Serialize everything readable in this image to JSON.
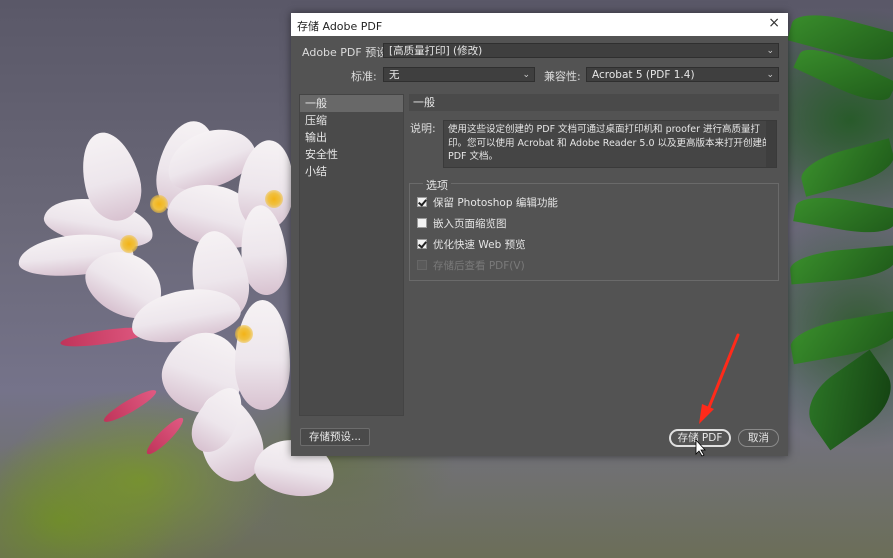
{
  "dialog": {
    "title": "存储 Adobe PDF",
    "close_label": "×"
  },
  "preset": {
    "label": "Adobe PDF 预设:",
    "value": "[高质量打印] (修改)"
  },
  "standard": {
    "label": "标准:",
    "value": "无"
  },
  "compat": {
    "label": "兼容性:",
    "value": "Acrobat 5 (PDF 1.4)"
  },
  "sidebar": {
    "items": [
      {
        "label": "一般",
        "active": true
      },
      {
        "label": "压缩",
        "active": false
      },
      {
        "label": "输出",
        "active": false
      },
      {
        "label": "安全性",
        "active": false
      },
      {
        "label": "小结",
        "active": false
      }
    ]
  },
  "panel": {
    "title": "一般",
    "desc_label": "说明:",
    "desc_text": "使用这些设定创建的 PDF 文档可通过桌面打印机和 proofer 进行高质量打印。您可以使用 Acrobat 和 Adobe Reader 5.0 以及更高版本来打开创建的 PDF 文档。",
    "options_title": "选项",
    "options": [
      {
        "label": "保留 Photoshop 编辑功能",
        "checked": true,
        "disabled": false
      },
      {
        "label": "嵌入页面缩览图",
        "checked": false,
        "disabled": false
      },
      {
        "label": "优化快速 Web 预览",
        "checked": true,
        "disabled": false
      },
      {
        "label": "存储后查看 PDF(V)",
        "checked": false,
        "disabled": true
      }
    ]
  },
  "buttons": {
    "save_preset": "存储预设...",
    "save_pdf": "存储 PDF",
    "cancel": "取消"
  },
  "colors": {
    "dialog_bg": "#535353",
    "annotation_arrow": "#ff2a1a"
  }
}
